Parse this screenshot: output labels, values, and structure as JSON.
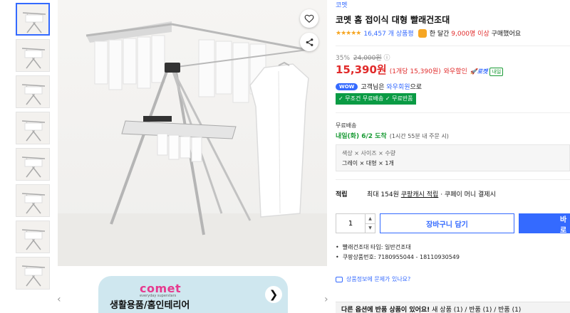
{
  "gallery": {
    "thumb_count": 8,
    "active_index": 0,
    "banner": {
      "logo": "comet",
      "tagline": "everyday superstars",
      "title": "생활용품/홈인테리어",
      "next_glyph": "❯"
    },
    "prev_arrow": "‹",
    "next_arrow": "›"
  },
  "product": {
    "brand": "코멧",
    "title": "코멧 홈 접이식 대형 빨래건조대",
    "rating": {
      "stars": "★★★★★",
      "review_count": "16,457 개 상품평",
      "buy_prefix": "한 달간",
      "buy_count": "9,000명 이상",
      "buy_suffix": "구매했어요"
    },
    "price": {
      "discount": "35%",
      "original": "24,000원",
      "info_icon": "ⓘ",
      "sale": "15,390원",
      "unit_price": "(1개당 15,390원)",
      "wow_sale": "와우할인",
      "rocket": "🚀로켓",
      "tomorrow": "내일"
    },
    "wow": {
      "pill": "WOW",
      "text_prefix": "고객님은",
      "member": "와우회원",
      "text_suffix": "으로"
    },
    "benefits": "✓ 무조건 무료배송  ✓ 무료반품",
    "shipping": {
      "label": "무료배송",
      "date": "내일(화) 6/2 도착",
      "note": "(1시간 55분 내 주문 시)"
    },
    "option": {
      "keys": "색상 × 사이즈 × 수량",
      "values": "그레이 × 대형 × 1개"
    },
    "points": {
      "label": "적립",
      "text": "최대 154원",
      "cash": "쿠팡캐시 적립",
      "suffix": "· 쿠페이 머니 결제시"
    },
    "quantity": "1",
    "cart_label": "장바구니 담기",
    "buy_label": "바로구매",
    "specs": [
      "빨래건조대 타입: 일반건조대",
      "쿠팡상품번호: 7180955044 - 18110930549"
    ],
    "report": "상품정보에 문제가 있나요?",
    "return_bar": {
      "bold": "다른 옵션에 반품 상품이 있어요!",
      "rest": "새 상품 (1) / 반품 (1) / 반품 (1)"
    }
  },
  "colors": {
    "accent": "#346aff",
    "price": "#e12b2b",
    "green": "#0a9b44"
  },
  "icons": {
    "favorite": "heart-icon",
    "share": "share-icon"
  }
}
